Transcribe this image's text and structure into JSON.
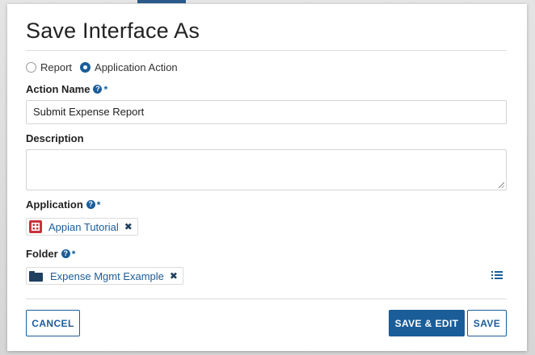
{
  "dialog": {
    "title": "Save Interface As"
  },
  "save_type": {
    "options": [
      "Report",
      "Application Action"
    ],
    "selected": "Application Action"
  },
  "action_name": {
    "label": "Action Name",
    "value": "Submit Expense Report",
    "required": true
  },
  "description": {
    "label": "Description",
    "value": ""
  },
  "application": {
    "label": "Application",
    "required": true,
    "selected": "Appian Tutorial"
  },
  "folder": {
    "label": "Folder",
    "required": true,
    "selected": "Expense Mgmt Example"
  },
  "common": {
    "help_glyph": "?",
    "required_glyph": "*",
    "remove_glyph": "✖"
  },
  "buttons": {
    "cancel": "CANCEL",
    "save_and_edit": "SAVE & EDIT",
    "save": "SAVE"
  },
  "colors": {
    "accent": "#1a5d99",
    "app_icon": "#c9333a",
    "folder_icon": "#1f3f5f"
  }
}
